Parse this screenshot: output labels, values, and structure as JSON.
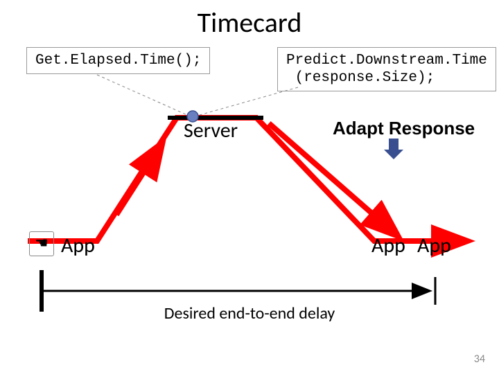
{
  "title": "Timecard",
  "code": {
    "left": "Get.Elapsed.Time();",
    "right": "Predict.Downstream.Time\n (response.Size);"
  },
  "labels": {
    "server": "Server",
    "adapt": "Adapt Response",
    "app1": "App",
    "app2": "App",
    "app3": "App",
    "desired": "Desired end-to-end delay",
    "hand_icon": "☚"
  },
  "page_number": "34"
}
